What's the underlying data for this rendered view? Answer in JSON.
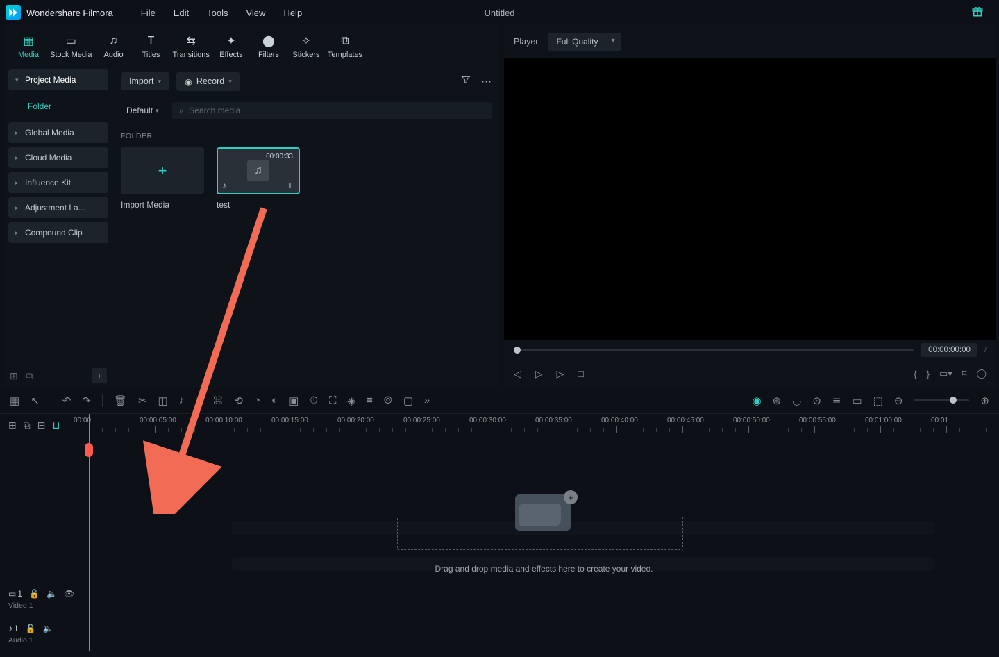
{
  "app": {
    "name": "Wondershare Filmora",
    "title": "Untitled"
  },
  "menu": [
    "File",
    "Edit",
    "Tools",
    "View",
    "Help"
  ],
  "toolTabs": [
    {
      "label": "Media",
      "icon": "▦",
      "active": true
    },
    {
      "label": "Stock Media",
      "icon": "▢"
    },
    {
      "label": "Audio",
      "icon": "♫"
    },
    {
      "label": "Titles",
      "icon": "T"
    },
    {
      "label": "Transitions",
      "icon": "⇄"
    },
    {
      "label": "Effects",
      "icon": "✦"
    },
    {
      "label": "Filters",
      "icon": "◑"
    },
    {
      "label": "Stickers",
      "icon": "✧"
    },
    {
      "label": "Templates",
      "icon": "⧉"
    }
  ],
  "sidebar": {
    "items": [
      "Project Media",
      "Global Media",
      "Cloud Media",
      "Influence Kit",
      "Adjustment La...",
      "Compound Clip"
    ],
    "sub": "Folder"
  },
  "content": {
    "importLabel": "Import",
    "recordLabel": "Record",
    "sortLabel": "Default",
    "searchPlaceholder": "Search media",
    "folderHeader": "FOLDER",
    "importMedia": "Import Media",
    "clip": {
      "name": "test",
      "duration": "00:00:33"
    }
  },
  "preview": {
    "headerLabel": "Player",
    "quality": "Full Quality",
    "timecode": "00:00:00:00"
  },
  "timeline": {
    "ticks": [
      "00:00",
      "00:00:05:00",
      "00:00:10:00",
      "00:00:15:00",
      "00:00:20:00",
      "00:00:25:00",
      "00:00:30:00",
      "00:00:35:00",
      "00:00:40:00",
      "00:00:45:00",
      "00:00:50:00",
      "00:00:55:00",
      "00:01:00:00",
      "00:01"
    ],
    "tracks": [
      {
        "type": "video",
        "label": "Video 1",
        "num": "1"
      },
      {
        "type": "audio",
        "label": "Audio 1",
        "num": "1"
      }
    ],
    "dropHint": "Drag and drop media and effects here to create your video."
  }
}
